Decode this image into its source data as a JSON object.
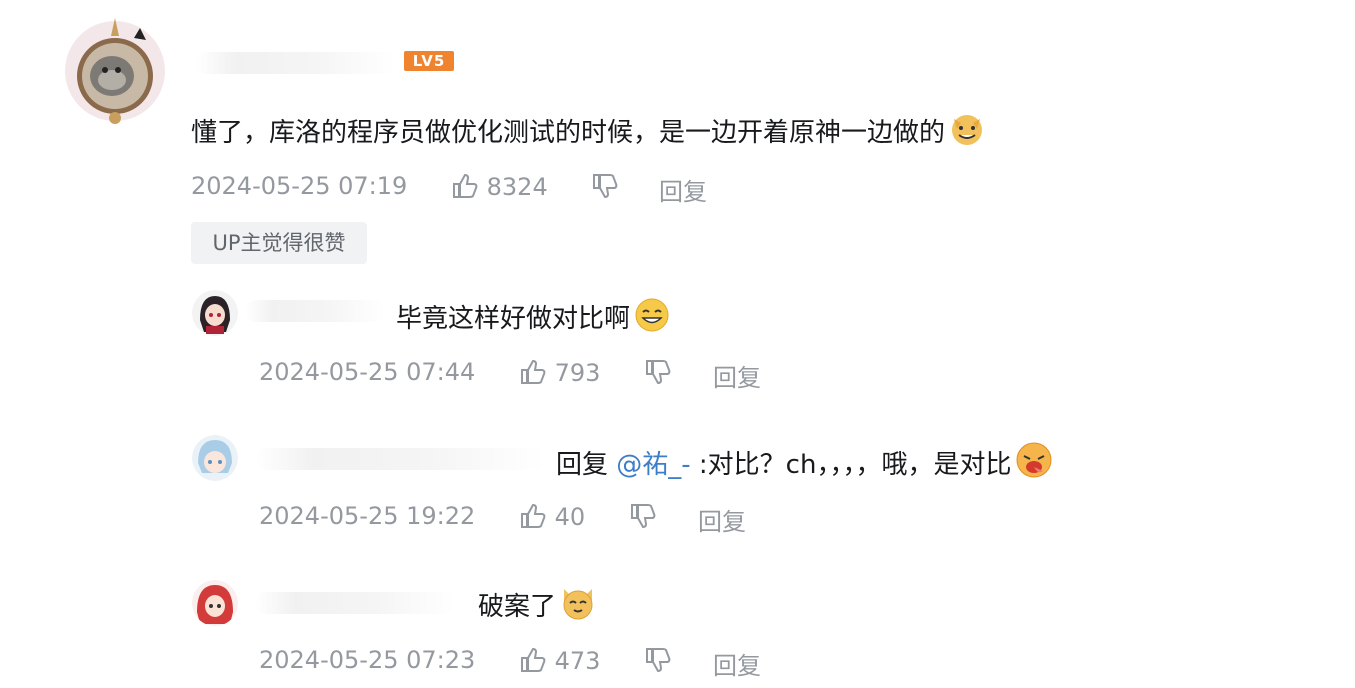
{
  "main_comment": {
    "level": "LV5",
    "content": "懂了，库洛的程序员做优化测试的时候，是一边开着原神一边做的",
    "emoji": "dog-grin-emoji",
    "time": "2024-05-25 07:19",
    "likes": "8324",
    "reply_label": "回复",
    "up_tag": "UP主觉得很赞"
  },
  "replies": [
    {
      "content": "毕竟这样好做对比啊",
      "emoji": "smile-emoji",
      "time": "2024-05-25 07:44",
      "likes": "793",
      "reply_label": "回复"
    },
    {
      "reply_prefix": "回复 ",
      "mention": "@祐_-",
      "content": " :对比？ch，，，，哦，是对比",
      "emoji": "hungry-emoji",
      "time": "2024-05-25 19:22",
      "likes": "40",
      "reply_label": "回复"
    },
    {
      "content": "破案了",
      "emoji": "cat-emoji",
      "time": "2024-05-25 07:23",
      "likes": "473",
      "reply_label": "回复"
    }
  ],
  "colors": {
    "meta": "#9499a0",
    "mention": "#3d7ec9",
    "level_badge": "#f0832d"
  }
}
